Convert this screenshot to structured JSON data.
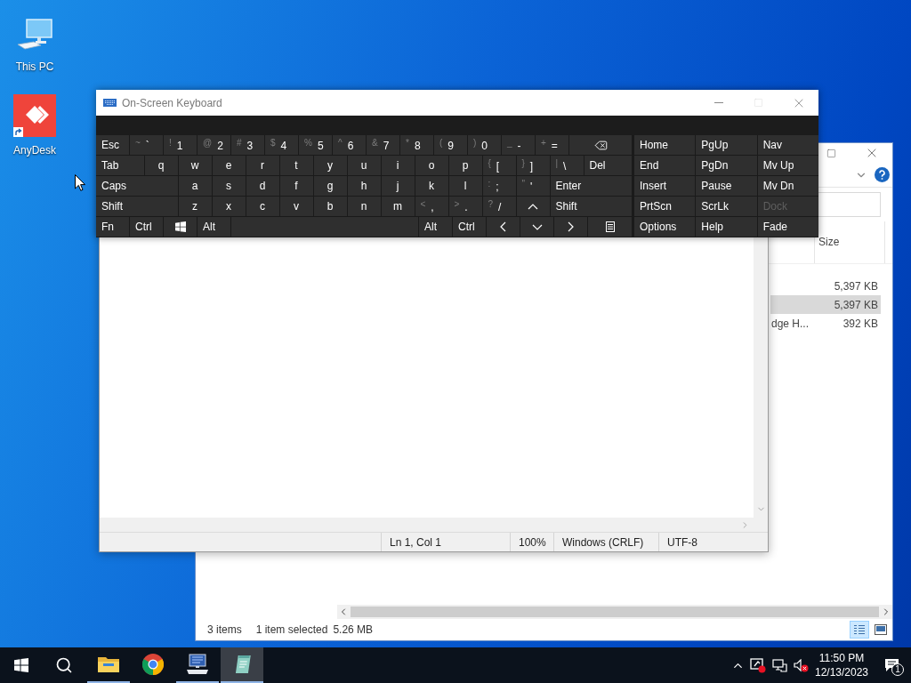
{
  "desktop": {
    "icons": [
      {
        "label": "This PC",
        "kind": "computer"
      },
      {
        "label": "AnyDesk",
        "kind": "shortcut"
      }
    ]
  },
  "explorer": {
    "columns": [
      "Size"
    ],
    "rows": [
      {
        "size": "5,397 KB",
        "selected": false
      },
      {
        "size": "5,397 KB",
        "selected": true
      },
      {
        "column_2": "dge H...",
        "size": "392 KB",
        "selected": false
      }
    ],
    "status": [
      "3 items",
      "1 item selected",
      "5.26 MB"
    ],
    "views": [
      {
        "kind": "details",
        "selected": true
      },
      {
        "kind": "tiles",
        "selected": false
      }
    ]
  },
  "notepad": {
    "status": [
      "Ln 1, Col 1",
      "100%",
      "Windows (CRLF)",
      "UTF-8"
    ]
  },
  "osk": {
    "title": "On-Screen Keyboard",
    "rows": [
      {
        "keys": [
          {
            "kind": "key",
            "label": "Esc"
          },
          {
            "kind": "symbol",
            "shift": "~",
            "label": "`"
          },
          {
            "kind": "symbol",
            "shift": "!",
            "label": "1"
          },
          {
            "kind": "symbol",
            "shift": "@",
            "label": "2"
          },
          {
            "kind": "symbol",
            "shift": "#",
            "label": "3"
          },
          {
            "kind": "symbol",
            "shift": "$",
            "label": "4"
          },
          {
            "kind": "symbol",
            "shift": "%",
            "label": "5"
          },
          {
            "kind": "symbol",
            "shift": "^",
            "label": "6"
          },
          {
            "kind": "symbol",
            "shift": "&",
            "label": "7"
          },
          {
            "kind": "symbol",
            "shift": "*",
            "label": "8"
          },
          {
            "kind": "symbol",
            "shift": "(",
            "label": "9"
          },
          {
            "kind": "symbol",
            "shift": ")",
            "label": "0"
          },
          {
            "kind": "symbol",
            "shift": "_",
            "label": "-"
          },
          {
            "kind": "symbol",
            "shift": "+",
            "label": "="
          },
          {
            "kind": "backspace"
          }
        ],
        "side": [
          {
            "label": "Home",
            "disabled": false
          },
          {
            "label": "PgUp",
            "disabled": false
          },
          {
            "label": "Nav",
            "disabled": false
          }
        ]
      },
      {
        "keys": [
          {
            "kind": "wide",
            "label": "Tab"
          },
          {
            "kind": "letter",
            "label": "q"
          },
          {
            "kind": "letter",
            "label": "w"
          },
          {
            "kind": "letter",
            "label": "e"
          },
          {
            "kind": "letter",
            "label": "r"
          },
          {
            "kind": "letter",
            "label": "t"
          },
          {
            "kind": "letter",
            "label": "y"
          },
          {
            "kind": "letter",
            "label": "u"
          },
          {
            "kind": "letter",
            "label": "i"
          },
          {
            "kind": "letter",
            "label": "o"
          },
          {
            "kind": "letter",
            "label": "p"
          },
          {
            "kind": "symbol",
            "shift": "{",
            "label": "["
          },
          {
            "kind": "symbol",
            "shift": "}",
            "label": "]"
          },
          {
            "kind": "symbol",
            "shift": "|",
            "label": "\\"
          },
          {
            "kind": "wide",
            "label": "Del"
          }
        ],
        "side": [
          {
            "label": "End",
            "disabled": false
          },
          {
            "label": "PgDn",
            "disabled": false
          },
          {
            "label": "Mv Up",
            "disabled": false
          }
        ]
      },
      {
        "keys": [
          {
            "kind": "wide",
            "label": "Caps"
          },
          {
            "kind": "letter",
            "label": "a"
          },
          {
            "kind": "letter",
            "label": "s"
          },
          {
            "kind": "letter",
            "label": "d"
          },
          {
            "kind": "letter",
            "label": "f"
          },
          {
            "kind": "letter",
            "label": "g"
          },
          {
            "kind": "letter",
            "label": "h"
          },
          {
            "kind": "letter",
            "label": "j"
          },
          {
            "kind": "letter",
            "label": "k"
          },
          {
            "kind": "letter",
            "label": "l"
          },
          {
            "kind": "symbol",
            "shift": ":",
            "label": ";"
          },
          {
            "kind": "symbol",
            "shift": "\"",
            "label": "'"
          },
          {
            "kind": "wide",
            "label": "Enter"
          }
        ],
        "side": [
          {
            "label": "Insert",
            "disabled": false
          },
          {
            "label": "Pause",
            "disabled": false
          },
          {
            "label": "Mv Dn",
            "disabled": false
          }
        ]
      },
      {
        "keys": [
          {
            "kind": "wide",
            "label": "Shift"
          },
          {
            "kind": "letter",
            "label": "z"
          },
          {
            "kind": "letter",
            "label": "x"
          },
          {
            "kind": "letter",
            "label": "c"
          },
          {
            "kind": "letter",
            "label": "v"
          },
          {
            "kind": "letter",
            "label": "b"
          },
          {
            "kind": "letter",
            "label": "n"
          },
          {
            "kind": "letter",
            "label": "m"
          },
          {
            "kind": "symbol",
            "shift": "<",
            "label": ","
          },
          {
            "kind": "symbol",
            "shift": ">",
            "label": "."
          },
          {
            "kind": "symbol",
            "shift": "?",
            "label": "/"
          },
          {
            "kind": "up"
          },
          {
            "kind": "wide",
            "label": "Shift"
          }
        ],
        "side": [
          {
            "label": "PrtScn",
            "disabled": false
          },
          {
            "label": "ScrLk",
            "disabled": false
          },
          {
            "label": "Dock",
            "disabled": true
          }
        ]
      },
      {
        "keys": [
          {
            "kind": "key",
            "label": "Fn"
          },
          {
            "kind": "key",
            "label": "Ctrl"
          },
          {
            "kind": "windows"
          },
          {
            "kind": "key",
            "label": "Alt"
          },
          {
            "kind": "space"
          },
          {
            "kind": "key",
            "label": "Alt"
          },
          {
            "kind": "key",
            "label": "Ctrl"
          },
          {
            "kind": "left"
          },
          {
            "kind": "down"
          },
          {
            "kind": "right"
          },
          {
            "kind": "menu"
          }
        ],
        "side": [
          {
            "label": "Options",
            "disabled": false
          },
          {
            "label": "Help",
            "disabled": false
          },
          {
            "label": "Fade",
            "disabled": false
          }
        ]
      }
    ]
  },
  "taskbar": {
    "apps": [
      {
        "kind": "folder",
        "running": true,
        "selected": false
      },
      {
        "kind": "browser",
        "running": false,
        "selected": false
      },
      {
        "kind": "keyboard",
        "running": true,
        "selected": false
      },
      {
        "kind": "notepad",
        "running": true,
        "selected": true
      }
    ],
    "time": "11:50 PM",
    "date": "12/13/2023",
    "notifications": "1"
  }
}
